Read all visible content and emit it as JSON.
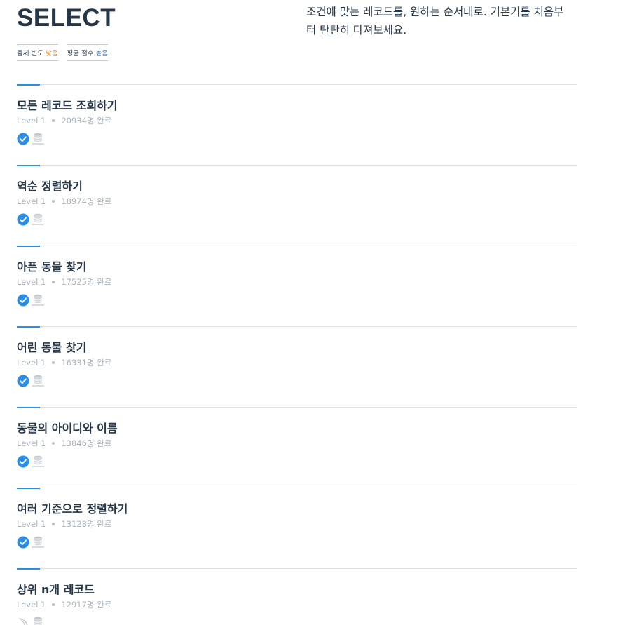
{
  "header": {
    "title": "SELECT",
    "description": "조건에 맞는 레코드를, 원하는 순서대로. 기본기를 처음부터 탄탄히 다져보세요.",
    "frequency_label": "출제 빈도",
    "frequency_value": "낮음",
    "score_label": "평균 점수",
    "score_value": "높음"
  },
  "colors": {
    "accent": "#2b8ee6",
    "frequency_low": "#e08a2d",
    "score_high": "#1f7ad6",
    "solved_check": "#2b8ee6"
  },
  "items": [
    {
      "title": "모든 레코드 조회하기",
      "level": "Level 1",
      "completed": "20934명 완료",
      "solved": true,
      "icons": [
        "check-circle-icon",
        "oracle-db-icon"
      ]
    },
    {
      "title": "역순 정렬하기",
      "level": "Level 1",
      "completed": "18974명 완료",
      "solved": true,
      "icons": [
        "check-circle-icon",
        "oracle-db-icon"
      ]
    },
    {
      "title": "아픈 동물 찾기",
      "level": "Level 1",
      "completed": "17525명 완료",
      "solved": true,
      "icons": [
        "check-circle-icon",
        "oracle-db-icon"
      ]
    },
    {
      "title": "어린 동물 찾기",
      "level": "Level 1",
      "completed": "16331명 완료",
      "solved": true,
      "icons": [
        "check-circle-icon",
        "oracle-db-icon"
      ]
    },
    {
      "title": "동물의 아이디와 이름",
      "level": "Level 1",
      "completed": "13846명 완료",
      "solved": true,
      "icons": [
        "check-circle-icon",
        "oracle-db-icon"
      ]
    },
    {
      "title": "여러 기준으로 정렬하기",
      "level": "Level 1",
      "completed": "13128명 완료",
      "solved": true,
      "icons": [
        "check-circle-icon",
        "oracle-db-icon"
      ]
    },
    {
      "title": "상위 n개 레코드",
      "level": "Level 1",
      "completed": "12917명 완료",
      "solved": false,
      "icons": [
        "mysql-dolphin-icon",
        "oracle-db-icon"
      ]
    }
  ]
}
